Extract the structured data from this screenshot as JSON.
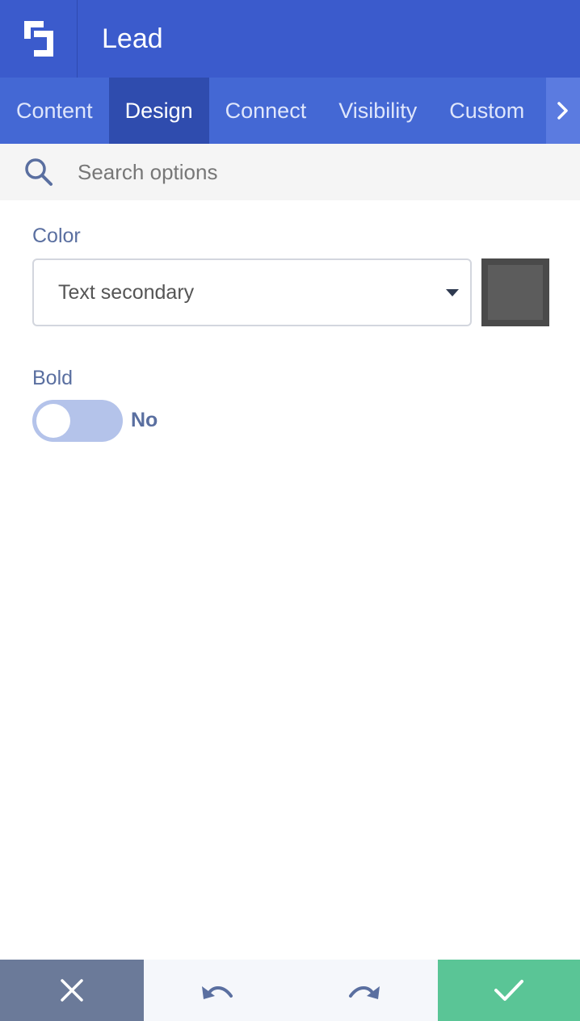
{
  "header": {
    "title": "Lead",
    "logo_icon": "builder-logo-icon"
  },
  "tabs": [
    {
      "label": "Content",
      "active": false
    },
    {
      "label": "Design",
      "active": true
    },
    {
      "label": "Connect",
      "active": false
    },
    {
      "label": "Visibility",
      "active": false
    },
    {
      "label": "Custom",
      "active": false
    }
  ],
  "search": {
    "placeholder": "Search options",
    "icon": "search-icon"
  },
  "color": {
    "label": "Color",
    "selected": "Text secondary",
    "swatch_color": "#5c5c5c"
  },
  "bold": {
    "label": "Bold",
    "value_text": "No",
    "enabled": false
  },
  "footer": {
    "cancel_icon": "close-icon",
    "undo_icon": "undo-icon",
    "redo_icon": "redo-icon",
    "confirm_icon": "check-icon",
    "cancel_color": "#6b7a99",
    "confirm_color": "#5ac596"
  },
  "theme": {
    "header_bg": "#3b5bcc",
    "tabs_bg": "#4468d4",
    "active_tab_bg": "#2f4cae",
    "label_color": "#5a6fa0"
  }
}
